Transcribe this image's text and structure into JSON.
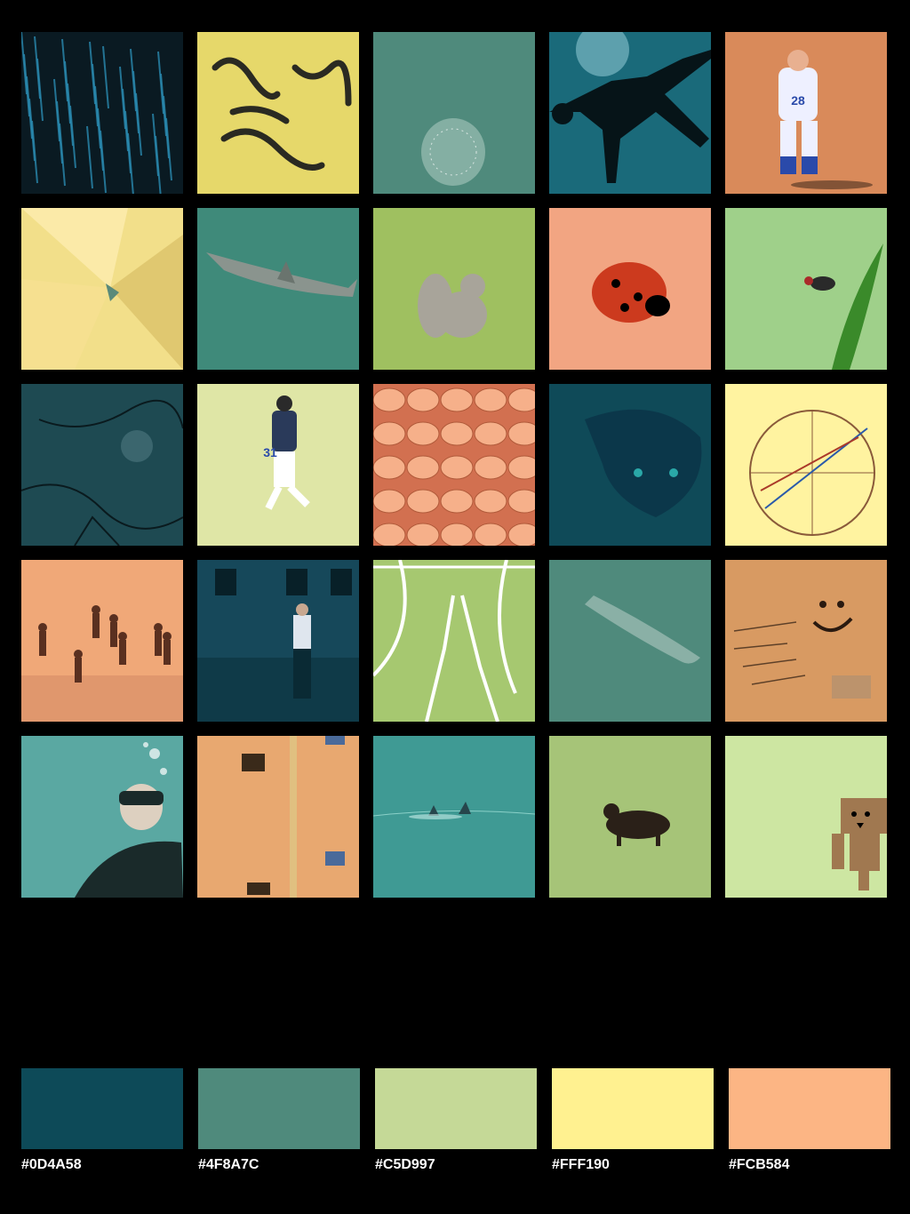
{
  "photos": [
    {
      "name": "teal-light-streaks-photo",
      "colors": [
        "#0a1a22",
        "#2a8ab0"
      ],
      "jersey": ""
    },
    {
      "name": "yellow-wall-shadow-photo",
      "colors": [
        "#e6d86a",
        "#2a2a22"
      ],
      "jersey": ""
    },
    {
      "name": "underwater-coral-photo",
      "colors": [
        "#4f8a7c",
        "#a8c8be"
      ],
      "jersey": ""
    },
    {
      "name": "diver-silhouette-photo",
      "colors": [
        "#1a6a7a",
        "#061418"
      ],
      "jersey": ""
    },
    {
      "name": "baseball-player-photo",
      "colors": [
        "#d98a5a",
        "#eef0ff"
      ],
      "jersey": "28"
    },
    {
      "name": "yellow-paper-fold-photo",
      "colors": [
        "#f2df8a",
        "#5a8a7a"
      ],
      "jersey": ""
    },
    {
      "name": "reef-shark-photo",
      "colors": [
        "#3f8a7a",
        "#a8c4b6"
      ],
      "jersey": ""
    },
    {
      "name": "squirrel-on-grass-photo",
      "colors": [
        "#9fc060",
        "#a8a49a"
      ],
      "jersey": ""
    },
    {
      "name": "ladybug-on-hand-photo",
      "colors": [
        "#f2a582",
        "#cc3a1e"
      ],
      "jersey": ""
    },
    {
      "name": "fly-on-leaf-photo",
      "colors": [
        "#9fd08a",
        "#3a8a2a"
      ],
      "jersey": ""
    },
    {
      "name": "textured-stone-photo",
      "colors": [
        "#1e4a52",
        "#4f7a82"
      ],
      "jersey": ""
    },
    {
      "name": "outfielder-running-photo",
      "colors": [
        "#dfe6a6",
        "#2a3a5a"
      ],
      "jersey": "31"
    },
    {
      "name": "beans-closeup-photo",
      "colors": [
        "#d27050",
        "#f6b08a"
      ],
      "jersey": ""
    },
    {
      "name": "fish-on-seabed-photo",
      "colors": [
        "#0f4a58",
        "#2aa8a8"
      ],
      "jersey": ""
    },
    {
      "name": "astrology-chart-photo",
      "colors": [
        "#fff3a0",
        "#8a5a3a"
      ],
      "jersey": ""
    },
    {
      "name": "children-on-beach-photo",
      "colors": [
        "#f0a878",
        "#5a3020"
      ],
      "jersey": ""
    },
    {
      "name": "street-building-photo",
      "colors": [
        "#0f3a48",
        "#dfe6ee"
      ],
      "jersey": ""
    },
    {
      "name": "field-chalk-lines-photo",
      "colors": [
        "#a6c870",
        "#ffffff"
      ],
      "jersey": ""
    },
    {
      "name": "lizard-fish-sand-photo",
      "colors": [
        "#4f8a7c",
        "#8ab0a6"
      ],
      "jersey": ""
    },
    {
      "name": "smiley-wall-graffiti-photo",
      "colors": [
        "#d89a62",
        "#2a1a10"
      ],
      "jersey": ""
    },
    {
      "name": "scuba-diver-photo",
      "colors": [
        "#5aa8a2",
        "#1a2a2a"
      ],
      "jersey": ""
    },
    {
      "name": "orange-wall-pipe-photo",
      "colors": [
        "#e8a870",
        "#4a6a9a"
      ],
      "jersey": ""
    },
    {
      "name": "dolphins-in-sea-photo",
      "colors": [
        "#3f9a94",
        "#26464c"
      ],
      "jersey": ""
    },
    {
      "name": "wild-animal-grass-photo",
      "colors": [
        "#a6c478",
        "#2a2018"
      ],
      "jersey": ""
    },
    {
      "name": "cardboard-robot-photo",
      "colors": [
        "#cde6a2",
        "#a07850"
      ],
      "jersey": ""
    }
  ],
  "palette": [
    {
      "color": "#0D4A58",
      "label": "#0D4A58"
    },
    {
      "color": "#4F8A7C",
      "label": "#4F8A7C"
    },
    {
      "color": "#C5D997",
      "label": "#C5D997"
    },
    {
      "color": "#FFF190",
      "label": "#FFF190"
    },
    {
      "color": "#FCB584",
      "label": "#FCB584"
    }
  ]
}
